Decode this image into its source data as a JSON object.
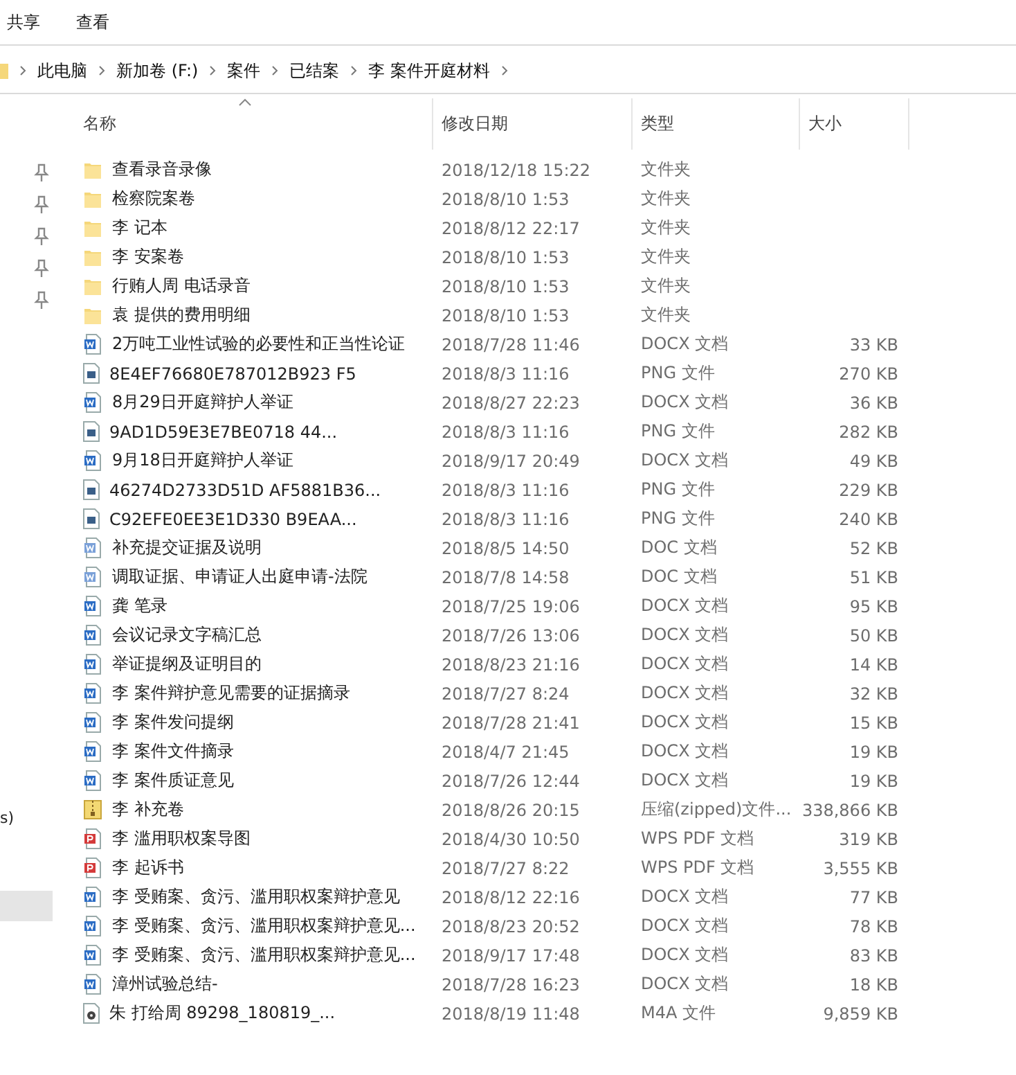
{
  "ribbon_tabs": [
    {
      "label": "共享"
    },
    {
      "label": "查看"
    }
  ],
  "breadcrumb": [
    "此电脑",
    "新加卷 (F:)",
    "案件",
    "已结案",
    "李 案件开庭材料"
  ],
  "nav_pane": {
    "pinned_count_items": [
      {
        "pinned": true
      },
      {
        "pinned": true
      },
      {
        "pinned": true
      },
      {
        "pinned": true
      },
      {
        "pinned": true
      }
    ],
    "partial_label": "s)",
    "highlighted_item": {
      "selected": true
    }
  },
  "table": {
    "columns": [
      {
        "label": "名称",
        "sorted": true
      },
      {
        "label": "修改日期",
        "sorted": false
      },
      {
        "label": "类型",
        "sorted": false
      },
      {
        "label": "大小",
        "sorted": false
      }
    ],
    "rows": [
      {
        "kind": "folder",
        "name": "查看录音录像",
        "date": "2018/12/18 15:22",
        "type": "文件夹"
      },
      {
        "kind": "folder",
        "name": "检察院案卷",
        "date": "2018/8/10 1:53",
        "type": "文件夹"
      },
      {
        "kind": "folder",
        "name": "李 记本",
        "date": "2018/8/12 22:17",
        "type": "文件夹"
      },
      {
        "kind": "folder",
        "name": "李 安案卷",
        "date": "2018/8/10 1:53",
        "type": "文件夹"
      },
      {
        "kind": "folder",
        "name": "行贿人周 电话录音",
        "date": "2018/8/10 1:53",
        "type": "文件夹"
      },
      {
        "kind": "folder",
        "name": "袁 提供的费用明细",
        "date": "2018/8/10 1:53",
        "type": "文件夹"
      },
      {
        "kind": "docx",
        "name": "2万吨工业性试验的必要性和正当性论证",
        "date": "2018/7/28 11:46",
        "type": "DOCX 文档",
        "size": "33 KB"
      },
      {
        "kind": "image",
        "name": "8E4EF76680E787012B923 F5",
        "date": "2018/8/3 11:16",
        "type": "PNG 文件",
        "size": "270 KB"
      },
      {
        "kind": "docx",
        "name": "8月29日开庭辩护人举证",
        "date": "2018/8/27 22:23",
        "type": "DOCX 文档",
        "size": "36 KB"
      },
      {
        "kind": "image",
        "name": "9AD1D59E3E7BE0718 44...",
        "date": "2018/8/3 11:16",
        "type": "PNG 文件",
        "size": "282 KB"
      },
      {
        "kind": "docx",
        "name": "9月18日开庭辩护人举证",
        "date": "2018/9/17 20:49",
        "type": "DOCX 文档",
        "size": "49 KB"
      },
      {
        "kind": "image",
        "name": "46274D2733D51D AF5881B36...",
        "date": "2018/8/3 11:16",
        "type": "PNG 文件",
        "size": "229 KB"
      },
      {
        "kind": "image",
        "name": "C92EFE0EE3E1D330 B9EAA...",
        "date": "2018/8/3 11:16",
        "type": "PNG 文件",
        "size": "240 KB"
      },
      {
        "kind": "doc",
        "name": "补充提交证据及说明",
        "date": "2018/8/5 14:50",
        "type": "DOC 文档",
        "size": "52 KB"
      },
      {
        "kind": "doc",
        "name": "调取证据、申请证人出庭申请-法院",
        "date": "2018/7/8 14:58",
        "type": "DOC 文档",
        "size": "51 KB"
      },
      {
        "kind": "docx",
        "name": "龚 笔录",
        "date": "2018/7/25 19:06",
        "type": "DOCX 文档",
        "size": "95 KB"
      },
      {
        "kind": "docx",
        "name": "会议记录文字稿汇总",
        "date": "2018/7/26 13:06",
        "type": "DOCX 文档",
        "size": "50 KB"
      },
      {
        "kind": "docx",
        "name": "举证提纲及证明目的",
        "date": "2018/8/23 21:16",
        "type": "DOCX 文档",
        "size": "14 KB"
      },
      {
        "kind": "docx",
        "name": "李 案件辩护意见需要的证据摘录",
        "date": "2018/7/27 8:24",
        "type": "DOCX 文档",
        "size": "32 KB"
      },
      {
        "kind": "docx",
        "name": "李 案件发问提纲",
        "date": "2018/7/28 21:41",
        "type": "DOCX 文档",
        "size": "15 KB"
      },
      {
        "kind": "docx",
        "name": "李 案件文件摘录",
        "date": "2018/4/7 21:45",
        "type": "DOCX 文档",
        "size": "19 KB"
      },
      {
        "kind": "docx",
        "name": "李 案件质证意见",
        "date": "2018/7/26 12:44",
        "type": "DOCX 文档",
        "size": "19 KB"
      },
      {
        "kind": "zip",
        "name": "李 补充卷",
        "date": "2018/8/26 20:15",
        "type": "压缩(zipped)文件...",
        "size": "338,866 KB"
      },
      {
        "kind": "pdf",
        "name": "李 滥用职权案导图",
        "date": "2018/4/30 10:50",
        "type": "WPS PDF 文档",
        "size": "319 KB"
      },
      {
        "kind": "pdf",
        "name": "李 起诉书",
        "date": "2018/7/27 8:22",
        "type": "WPS PDF 文档",
        "size": "3,555 KB"
      },
      {
        "kind": "docx",
        "name": "李 受贿案、贪污、滥用职权案辩护意见",
        "date": "2018/8/12 22:16",
        "type": "DOCX 文档",
        "size": "77 KB"
      },
      {
        "kind": "docx",
        "name": "李 受贿案、贪污、滥用职权案辩护意见...",
        "date": "2018/8/23 20:52",
        "type": "DOCX 文档",
        "size": "78 KB"
      },
      {
        "kind": "docx",
        "name": "李 受贿案、贪污、滥用职权案辩护意见...",
        "date": "2018/9/17 17:48",
        "type": "DOCX 文档",
        "size": "83 KB"
      },
      {
        "kind": "docx",
        "name": "漳州试验总结-",
        "date": "2018/7/28 16:23",
        "type": "DOCX 文档",
        "size": "18 KB"
      },
      {
        "kind": "audio",
        "name": "朱 打给周 89298_180819_...",
        "date": "2018/8/19 11:48",
        "type": "M4A 文件",
        "size": "9,859 KB"
      }
    ]
  }
}
